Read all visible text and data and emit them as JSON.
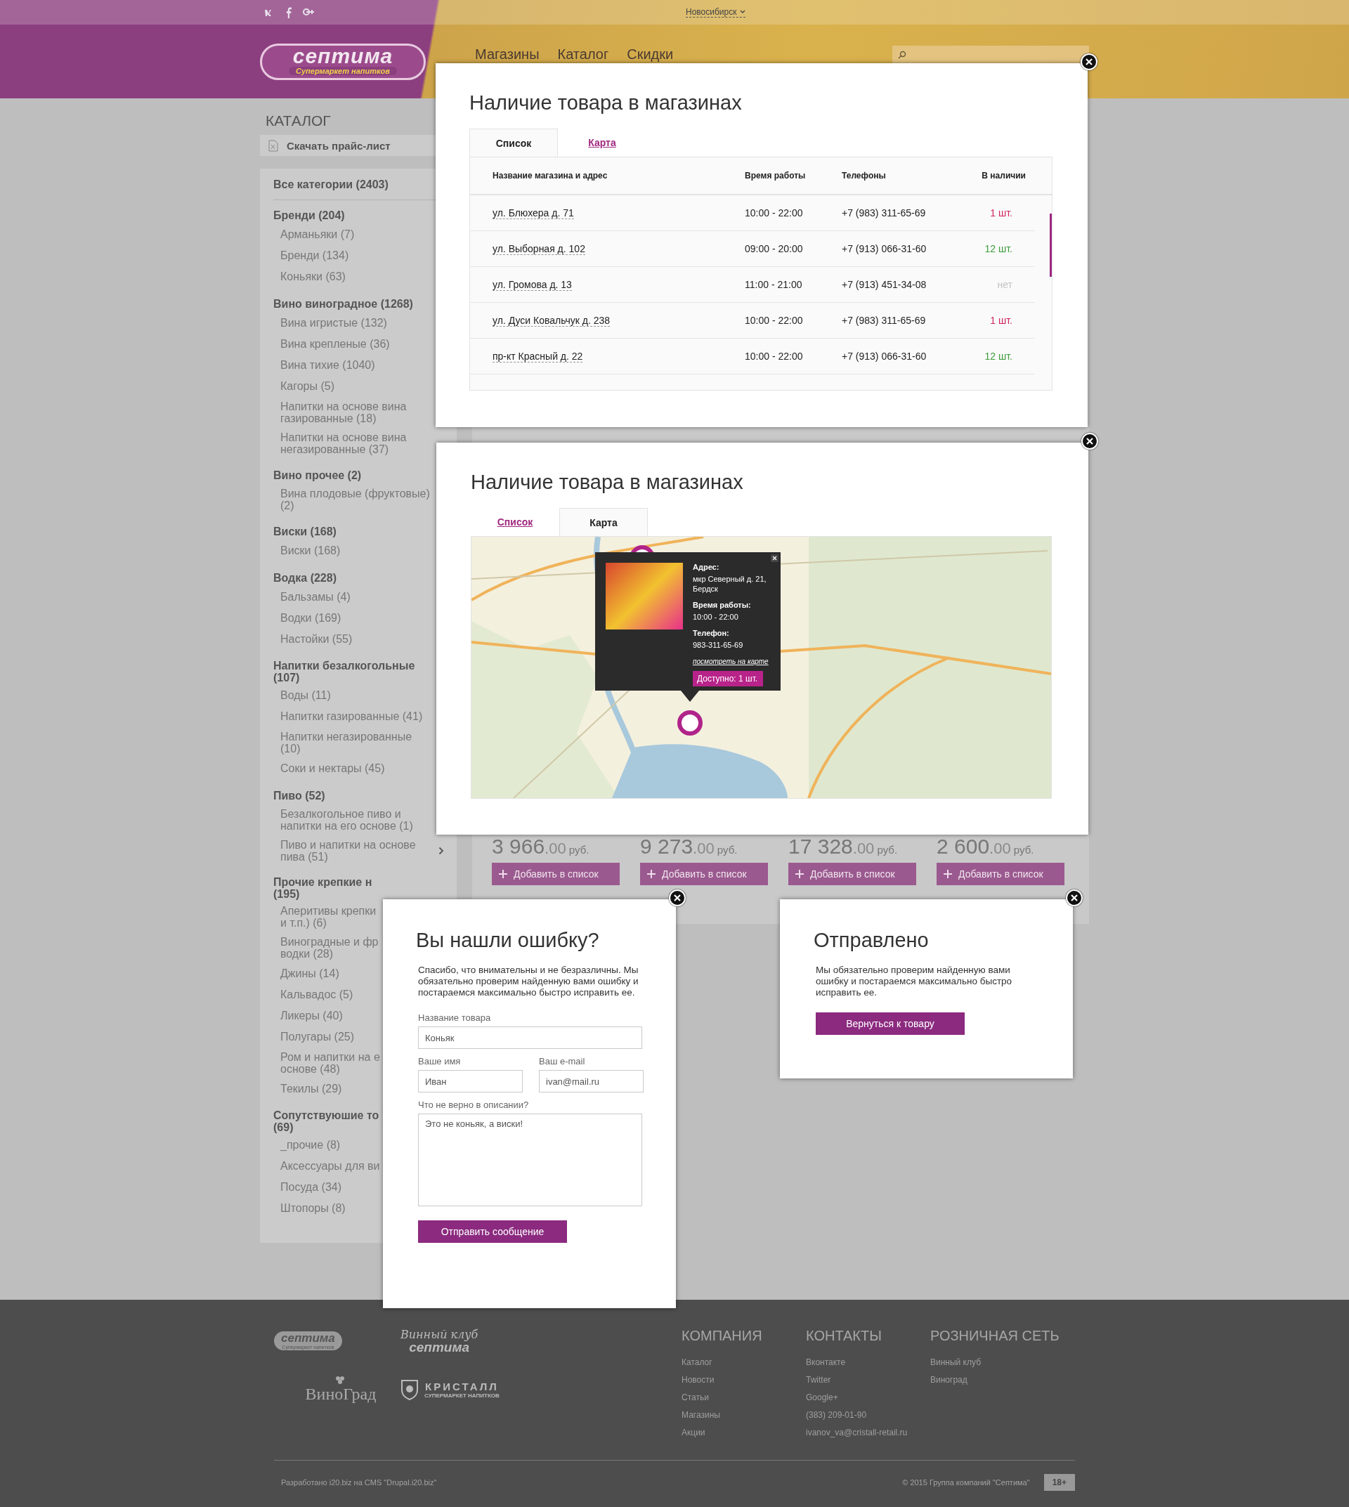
{
  "header": {
    "city": "Новосибирск",
    "logo": {
      "name": "септима",
      "tagline": "Супермаркет напитков"
    },
    "nav": [
      "Магазины",
      "Каталог",
      "Скидки"
    ]
  },
  "sidebar": {
    "title": "КАТАЛОГ",
    "price_list": "Скачать прайс-лист",
    "all": "Все категории (2403)",
    "groups": [
      {
        "label": "Бренди (204)",
        "children": [
          {
            "label": "Арманьяки (7)"
          },
          {
            "label": "Бренди (134)"
          },
          {
            "label": "Коньяки (63)"
          }
        ]
      },
      {
        "label": "Вино виноградное (1268)",
        "children": [
          {
            "label": "Вина игристые (132)"
          },
          {
            "label": "Вина крепленые (36)"
          },
          {
            "label": "Вина тихие (1040)"
          },
          {
            "label": "Кагоры (5)"
          },
          {
            "lines": [
              "Напитки на основе вина",
              "газированные (18)"
            ]
          },
          {
            "lines": [
              "Напитки на основе вина",
              "негазированные (37)"
            ]
          }
        ]
      },
      {
        "label": "Вино прочее (2)",
        "children": [
          {
            "lines": [
              "Вина плодовые (фруктовые)",
              "(2)"
            ]
          }
        ]
      },
      {
        "label": "Виски (168)",
        "children": [
          {
            "label": "Виски (168)"
          }
        ]
      },
      {
        "label": "Водка (228)",
        "children": [
          {
            "label": "Бальзамы (4)"
          },
          {
            "label": "Водки (169)"
          },
          {
            "label": "Настойки (55)"
          }
        ]
      },
      {
        "lines": [
          "Напитки безалкогольные",
          "(107)"
        ],
        "children": [
          {
            "label": "Воды (11)"
          },
          {
            "label": "Напитки газированные (41)"
          },
          {
            "lines": [
              "Напитки негазированные",
              "(10)"
            ]
          },
          {
            "label": "Соки и нектары (45)"
          }
        ]
      },
      {
        "label": "Пиво (52)",
        "children": [
          {
            "lines": [
              "Безалкогольное пиво и",
              "напитки на его основе (1)"
            ],
            "expandable": false
          },
          {
            "lines": [
              "Пиво и напитки на основе",
              "пива (51)"
            ],
            "expandable": true
          }
        ]
      },
      {
        "lines": [
          "Прочие крепкие н",
          "(195)"
        ],
        "children": [
          {
            "lines": [
              "Аперитивы крепки",
              "и т.п.) (6)"
            ]
          },
          {
            "lines": [
              "Виноградные и фр",
              "водки (28)"
            ]
          },
          {
            "label": "Джины (14)"
          },
          {
            "label": "Кальвадос (5)"
          },
          {
            "label": "Ликеры (40)"
          },
          {
            "label": "Полугары (25)"
          },
          {
            "lines": [
              "Ром и напитки на е",
              "основе (48)"
            ]
          },
          {
            "label": "Текилы (29)"
          }
        ]
      },
      {
        "lines": [
          "Сопутствуюшие то",
          "(69)"
        ],
        "children": [
          {
            "label": "_прочие (8)"
          },
          {
            "label": "Аксессуары для ви"
          },
          {
            "label": "Посуда (34)"
          },
          {
            "label": "Штопоры (8)"
          }
        ]
      }
    ]
  },
  "products": [
    {
      "price": "3 966",
      "cents": ".00",
      "currency": "руб.",
      "button": "Добавить в список"
    },
    {
      "price": "9 273",
      "cents": ".00",
      "currency": "руб.",
      "button": "Добавить в список"
    },
    {
      "price": "17 328",
      "cents": ".00",
      "currency": "руб.",
      "button": "Добавить в список"
    },
    {
      "price": "2 600",
      "cents": ".00",
      "currency": "руб.",
      "button": "Добавить в список"
    }
  ],
  "stock_popup": {
    "title": "Наличие товара в магазинах",
    "tabs": [
      {
        "label": "Список",
        "selected": true
      },
      {
        "label": "Карта",
        "selected": false
      }
    ],
    "table": {
      "columns": [
        "Название магазина и адрес",
        "Время работы",
        "Телефоны",
        "В наличии"
      ],
      "rows": [
        {
          "address": "ул. Блюхера д. 71",
          "hours": "10:00 - 22:00",
          "phone": "+7 (983) 311-65-69",
          "stock": "1 шт.",
          "color": "#d1245a"
        },
        {
          "address": "ул. Выборная д. 102",
          "hours": "09:00 - 20:00",
          "phone": "+7 (913) 066-31-60",
          "stock": "12 шт.",
          "color": "#3c9c3c"
        },
        {
          "address": "ул. Громова д. 13",
          "hours": "11:00 - 21:00",
          "phone": "+7 (913) 451-34-08",
          "stock": "нет",
          "color": "#c4c4c4"
        },
        {
          "address": "ул. Дуси Ковальчук д. 238",
          "hours": "10:00 - 22:00",
          "phone": "+7 (983) 311-65-69",
          "stock": "1 шт.",
          "color": "#d1245a"
        },
        {
          "address": "пр-кт Красный д. 22",
          "hours": "10:00 - 22:00",
          "phone": "+7 (913) 066-31-60",
          "stock": "12 шт.",
          "color": "#3c9c3c"
        }
      ]
    }
  },
  "map_popup": {
    "title": "Наличие товара в магазинах",
    "tabs": [
      {
        "label": "Список",
        "selected": false
      },
      {
        "label": "Карта",
        "selected": true
      }
    ],
    "map": {
      "info": {
        "address_label": "Адрес:",
        "address": "мкр Северный д. 21, Бердск",
        "hours_label": "Время работы:",
        "hours": "10:00 - 22:00",
        "phone_label": "Телефон:",
        "phone": "983-311-65-69",
        "link": "посмотреть на карте",
        "available": "Доступно: 1 шт."
      }
    }
  },
  "error_popup": {
    "title": "Вы нашли ошибку?",
    "text": "Спасибо, что внимательны и не безразличны. Мы обязательно проверим найденную вами ошибку и постараемся максимально быстро исправить ее.",
    "product_label": "Название товара",
    "product": "Коньяк",
    "name_label": "Ваше имя",
    "name": "Иван",
    "email_label": "Ваш e-mail",
    "email": "ivan@mail.ru",
    "issue_label": "Что не верно в описании?",
    "issue": "Это не коньяк, а виски!",
    "submit": "Отправить сообщение"
  },
  "sent_popup": {
    "title": "Отправлено",
    "text": "Мы обязательно проверим найденную вами ошибку и постараемся максимально быстро исправить ее.",
    "button": "Вернуться к товару"
  },
  "footer": {
    "logos": [
      {
        "kind": "septima",
        "lines": [
          "септима",
          "Супермаркет напитков"
        ]
      },
      {
        "kind": "club",
        "lines": [
          "Винный клуб",
          "септима"
        ]
      },
      {
        "kind": "vinograd",
        "lines": [
          "ВиноГрад"
        ]
      },
      {
        "kind": "kristall",
        "lines": [
          "КРИСТАЛЛ",
          "СУПЕРМАРКЕТ НАПИТКОВ"
        ]
      }
    ],
    "columns": [
      {
        "title": "КОМПАНИЯ",
        "links": [
          "Каталог",
          "Новости",
          "Статьи",
          "Магазины",
          "Акции"
        ]
      },
      {
        "title": "КОНТАКТЫ",
        "links": [
          "Вконтакте",
          "Twitter",
          "Google+",
          "(383) 209-01-90",
          "ivanov_va@cristall-retail.ru"
        ]
      },
      {
        "title": "РОЗНИЧНАЯ СЕТЬ",
        "links": [
          "Винный клуб",
          "Виноград"
        ]
      }
    ],
    "credit": "Разработано i20.biz на CMS \"Drupal.i20.biz\"",
    "copyright": "© 2015 Группа компаний \"Септима\"",
    "age": "18+"
  }
}
